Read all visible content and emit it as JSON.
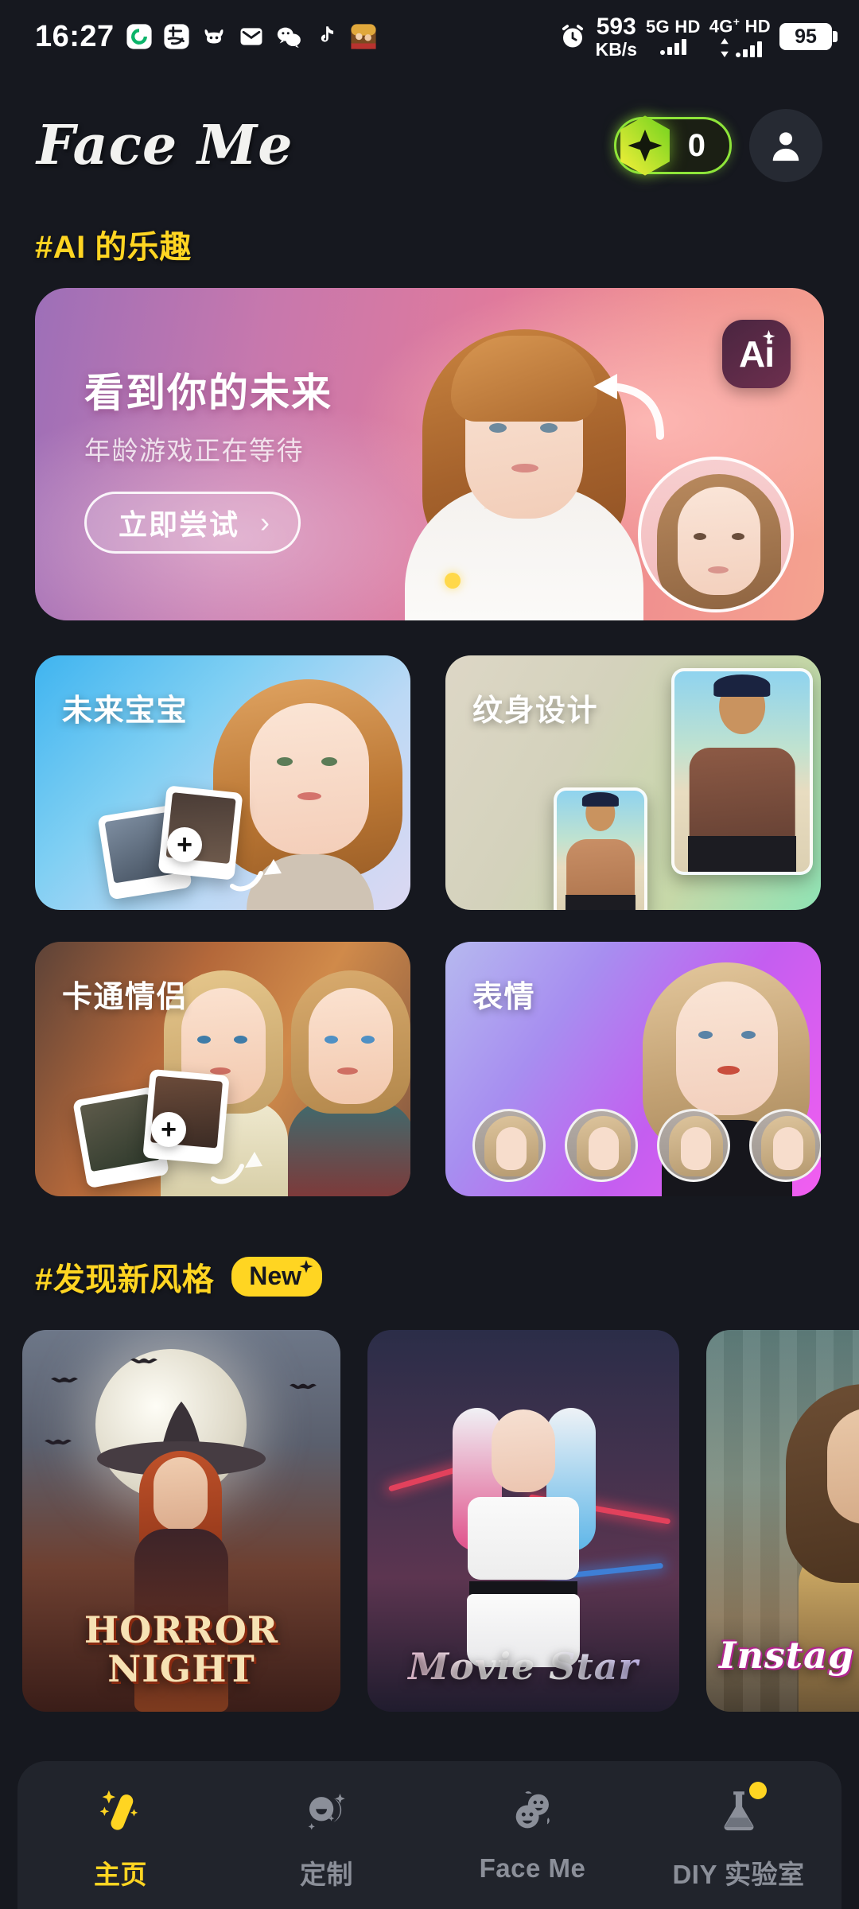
{
  "status_bar": {
    "time": "16:27",
    "app_icons": [
      "sync-icon",
      "alipay-icon",
      "hornet-icon",
      "mail-icon",
      "wechat-icon",
      "tiktok-icon",
      "game-icon"
    ],
    "alarm_icon": "alarm-icon",
    "network_speed_value": "593",
    "network_speed_unit": "KB/s",
    "sim1_label": "5G",
    "sim1_hd": "HD",
    "sim2_label": "4G",
    "sim2_sup": "+",
    "sim2_hd": "HD",
    "battery_percent": "95"
  },
  "header": {
    "brand": "Face Me",
    "credits_value": "0",
    "gem_icon": "diamond-gem-icon",
    "avatar_icon": "user-avatar-icon"
  },
  "sections": {
    "ai_fun": {
      "title": "#AI 的乐趣"
    },
    "new_styles": {
      "title": "#发现新风格",
      "badge": "New",
      "badge_sparkle": "sparkle-icon"
    }
  },
  "hero": {
    "title": "看到你的未来",
    "subtitle": "年龄游戏正在等待",
    "cta_label": "立即尝试",
    "cta_chevron": "chevron-right-icon",
    "ai_badge_text": "Ai",
    "ai_badge_sparkle": "sparkle-icon",
    "arrow_icon": "curved-arrow-icon",
    "thumbnail": "child-face-thumbnail"
  },
  "feature_cards": [
    {
      "id": "baby",
      "label": "未来宝宝",
      "plus_icon": "plus-icon",
      "arrow_icon": "curved-arrow-icon"
    },
    {
      "id": "tattoo",
      "label": "纹身设计"
    },
    {
      "id": "couple",
      "label": "卡通情侣",
      "plus_icon": "plus-icon",
      "arrow_icon": "curved-arrow-icon"
    },
    {
      "id": "emoji",
      "label": "表情"
    }
  ],
  "style_cards": [
    {
      "id": "horror",
      "caption_line1": "HORROR",
      "caption_line2": "NIGHT"
    },
    {
      "id": "movie",
      "caption": "Movie Star"
    },
    {
      "id": "insta",
      "caption": "Instag"
    }
  ],
  "bottom_nav": [
    {
      "id": "home",
      "label": "主页",
      "icon": "magic-wand-icon",
      "active": true,
      "badge": false
    },
    {
      "id": "custom",
      "label": "定制",
      "icon": "faces-sparkle-icon",
      "active": false,
      "badge": false
    },
    {
      "id": "faceme",
      "label": "Face Me",
      "icon": "two-faces-icon",
      "active": false,
      "badge": false
    },
    {
      "id": "diylab",
      "label": "DIY 实验室",
      "icon": "flask-icon",
      "active": false,
      "badge": true
    }
  ],
  "colors": {
    "background": "#16181f",
    "accent_yellow": "#ffd522",
    "credits_green": "#8ee53a",
    "nav_bar": "#21242c",
    "nav_inactive": "#8b8f99"
  }
}
